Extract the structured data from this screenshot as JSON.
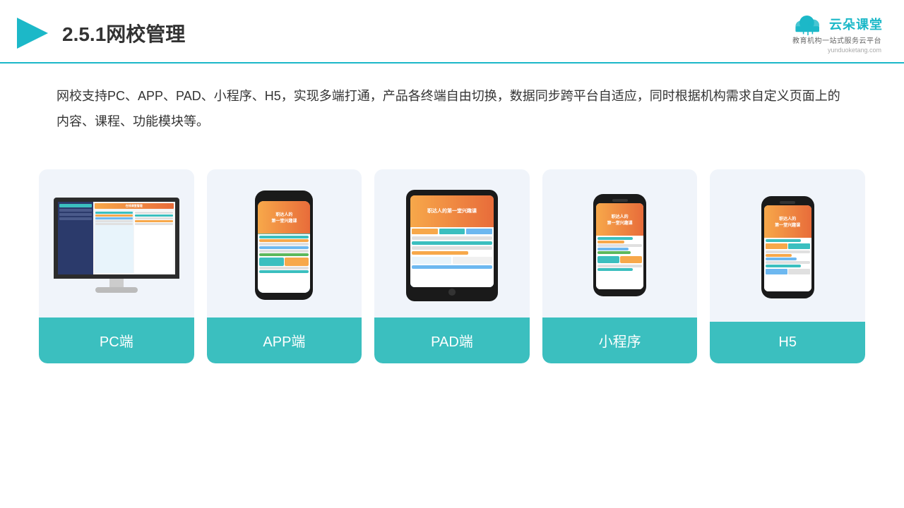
{
  "header": {
    "title": "2.5.1网校管理",
    "logo_text": "云朵课堂",
    "logo_sub": "教育机构一站\n式服务云平台",
    "logo_url": "yunduoketang.com"
  },
  "description": "网校支持PC、APP、PAD、小程序、H5，实现多端打通，产品各终端自由切换，数据同步跨平台自适应，同时根据机构需求自定义页面上的内容、课程、功能模块等。",
  "cards": [
    {
      "id": "pc",
      "label": "PC端"
    },
    {
      "id": "app",
      "label": "APP端"
    },
    {
      "id": "pad",
      "label": "PAD端"
    },
    {
      "id": "mini",
      "label": "小程序"
    },
    {
      "id": "h5",
      "label": "H5"
    }
  ]
}
